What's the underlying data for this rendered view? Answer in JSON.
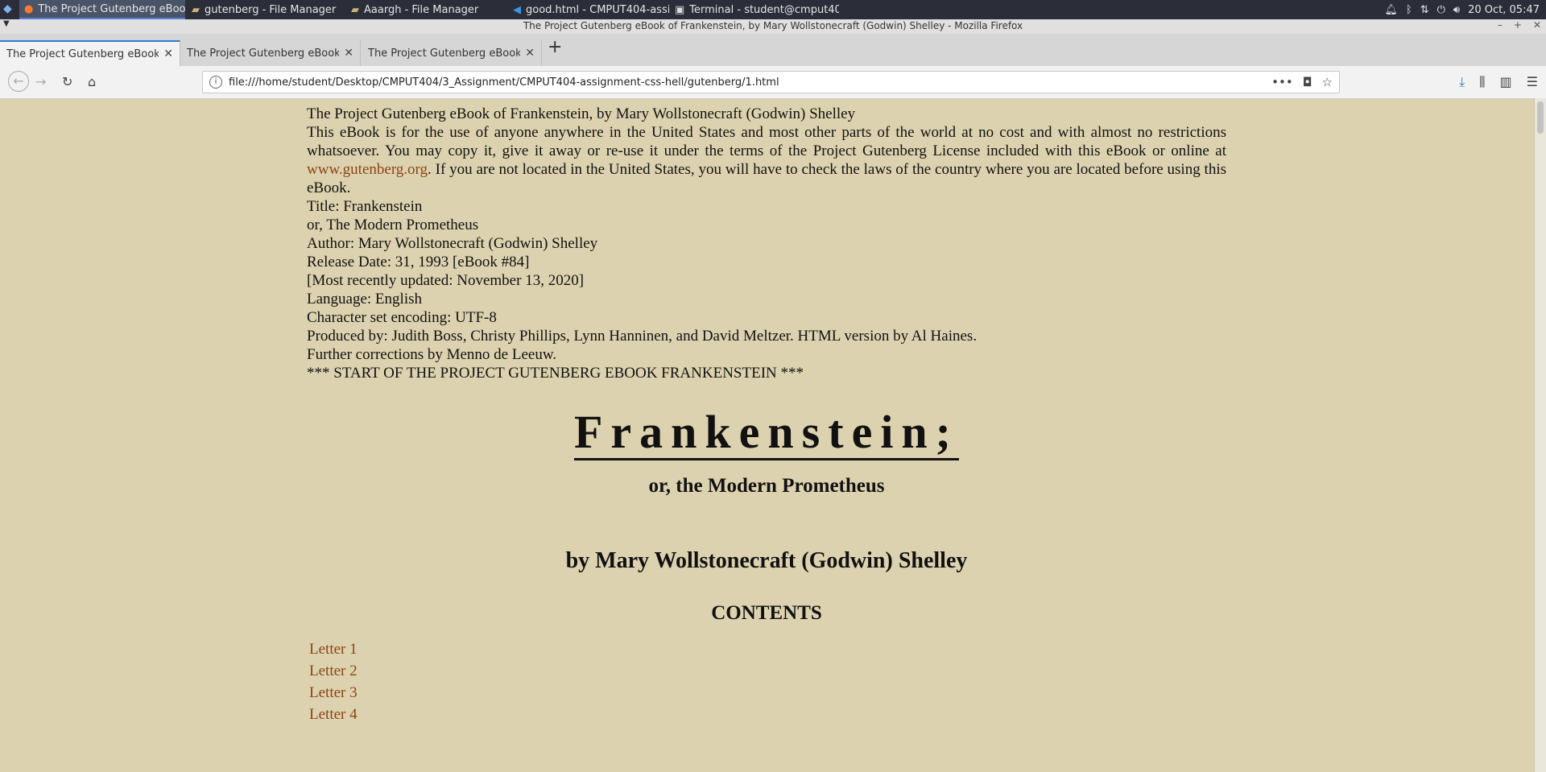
{
  "taskbar": {
    "items": [
      {
        "label": "The Project Gutenberg eBoo..."
      },
      {
        "label": "gutenberg - File Manager"
      },
      {
        "label": "Aaargh - File Manager"
      },
      {
        "label": "good.html - CMPUT404-assi..."
      },
      {
        "label": "Terminal - student@cmput40..."
      }
    ],
    "clock": "20 Oct, 05:47"
  },
  "window": {
    "title": "The Project Gutenberg eBook of Frankenstein, by Mary Wollstonecraft (Godwin) Shelley - Mozilla Firefox"
  },
  "tabs": [
    {
      "label": "The Project Gutenberg eBook of F"
    },
    {
      "label": "The Project Gutenberg eBook of F"
    },
    {
      "label": "The Project Gutenberg eBook of T"
    }
  ],
  "url": "file:///home/student/Desktop/CMPUT404/3_Assignment/CMPUT404-assignment-css-hell/gutenberg/1.html",
  "doc": {
    "line1": "The Project Gutenberg eBook of Frankenstein, by Mary Wollstonecraft (Godwin) Shelley",
    "intro_a": "This eBook is for the use of anyone anywhere in the United States and most other parts of the world at no cost and with almost no restrictions whatsoever. You may copy it, give it away or re-use it under the terms of the Project Gutenberg License included with this eBook or online at ",
    "intro_link": "www.gutenberg.org",
    "intro_b": ". If you are not located in the United States, you will have to check the laws of the country where you are located before using this eBook.",
    "title": "Title: Frankenstein",
    "subtitle": "or, The Modern Prometheus",
    "author": "Author: Mary Wollstonecraft (Godwin) Shelley",
    "release": "Release Date: 31, 1993 [eBook #84]",
    "updated": "[Most recently updated: November 13, 2020]",
    "language": "Language: English",
    "charset": "Character set encoding: UTF-8",
    "produced": "Produced by: Judith Boss, Christy Phillips, Lynn Hanninen, and David Meltzer. HTML version by Al Haines.",
    "corrections": "Further corrections by Menno de Leeuw.",
    "start": "*** START OF THE PROJECT GUTENBERG EBOOK FRANKENSTEIN ***",
    "h1": "Frankenstein;",
    "h2": "or, the Modern Prometheus",
    "h3": "by Mary Wollstonecraft (Godwin) Shelley",
    "contents": "CONTENTS",
    "toc": [
      "Letter 1",
      "Letter 2",
      "Letter 3",
      "Letter 4"
    ]
  }
}
